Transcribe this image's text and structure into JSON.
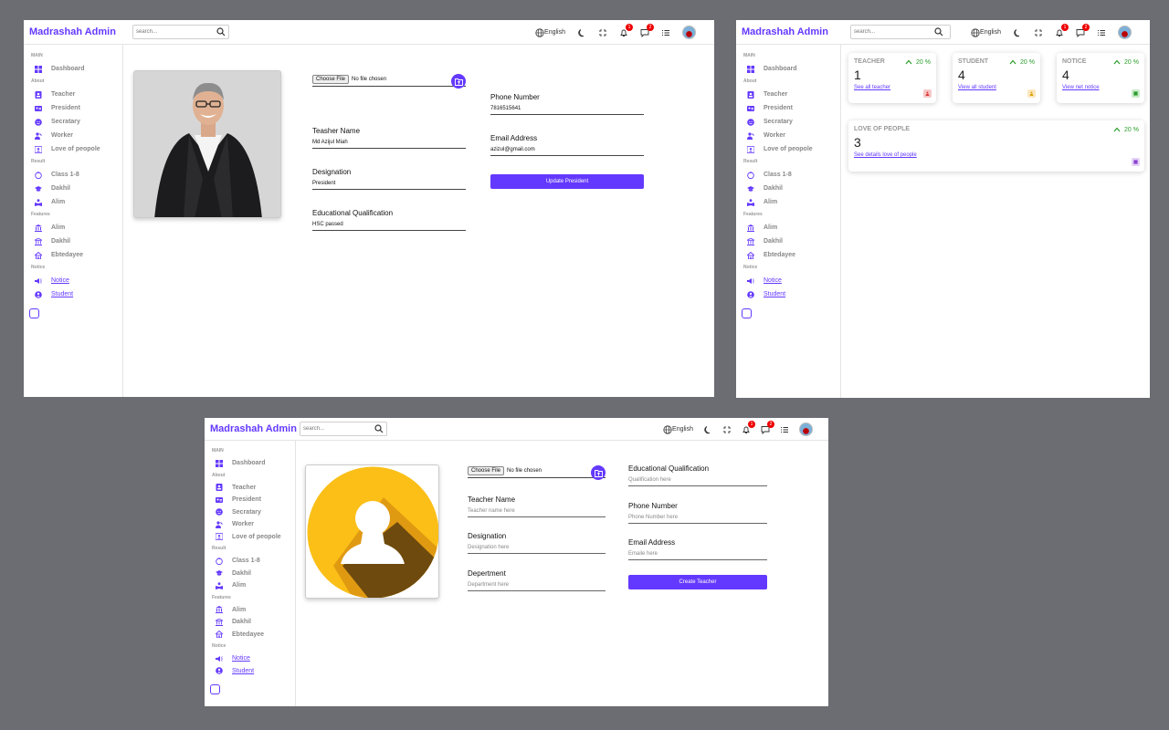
{
  "app": {
    "title": "Madrashah Admin",
    "search_placeholder": "search...",
    "language": "English",
    "notif_count": "1",
    "msg_count": "2"
  },
  "sidebar": {
    "main": "MAIN",
    "dashboard": "Dashboard",
    "about": "About",
    "teacher": "Teacher",
    "president": "President",
    "secretary": "Secratary",
    "worker": "Worker",
    "love": "Love of peopole",
    "result": "Result",
    "class18": "Class 1-8",
    "dakhil": "Dakhil",
    "alim": "Alim",
    "features": "Features",
    "f_alim": "Alim",
    "f_dakhil": "Dakhil",
    "f_ebtedayee": "Ebtedayee",
    "notice_sec": "Notice",
    "notice": "Notice",
    "student": "Student"
  },
  "president_form": {
    "choose_file": "Choose File",
    "no_file": "No file chosen",
    "name_label": "Teasher Name",
    "name_value": "Md Azijul Miah",
    "designation_label": "Designation",
    "designation_value": "President",
    "qualification_label": "Educational Qualification",
    "qualification_value": "HSC passed",
    "phone_label": "Phone Number",
    "phone_value": "7816515641",
    "email_label": "Email Address",
    "email_value": "azizul@gmail.com",
    "submit": "Update President"
  },
  "dashboard": {
    "cards": [
      {
        "title": "TEACHER",
        "pct": "20 %",
        "count": "1",
        "link": "See all teacher",
        "icon_color": "#f5c6c6",
        "icon_fg": "#d33"
      },
      {
        "title": "STUDENT",
        "pct": "20 %",
        "count": "4",
        "link": "View all student",
        "icon_color": "#fbe7c0",
        "icon_fg": "#d9a100"
      },
      {
        "title": "NOTICE",
        "pct": "20 %",
        "count": "4",
        "link": "View net notice",
        "icon_color": "#c9ebc9",
        "icon_fg": "#2a9d2a"
      },
      {
        "title": "LOVE OF PEOPLE",
        "pct": "20 %",
        "count": "3",
        "link": "See details love of people",
        "icon_color": "#e3d2f5",
        "icon_fg": "#8a3fd1"
      }
    ]
  },
  "teacher_form": {
    "choose_file": "Choose File",
    "no_file": "No file chosen",
    "name_label": "Teacher Name",
    "name_placeholder": "Teacher name here",
    "designation_label": "Designation",
    "designation_placeholder": "Designation here",
    "department_label": "Depertment",
    "department_placeholder": "Department here",
    "qualification_label": "Educational Qualification",
    "qualification_placeholder": "Qualification here",
    "phone_label": "Phone Number",
    "phone_placeholder": "Phone Number here",
    "email_label": "Email Address",
    "email_placeholder": "Emaile here",
    "submit": "Create Teacher"
  }
}
